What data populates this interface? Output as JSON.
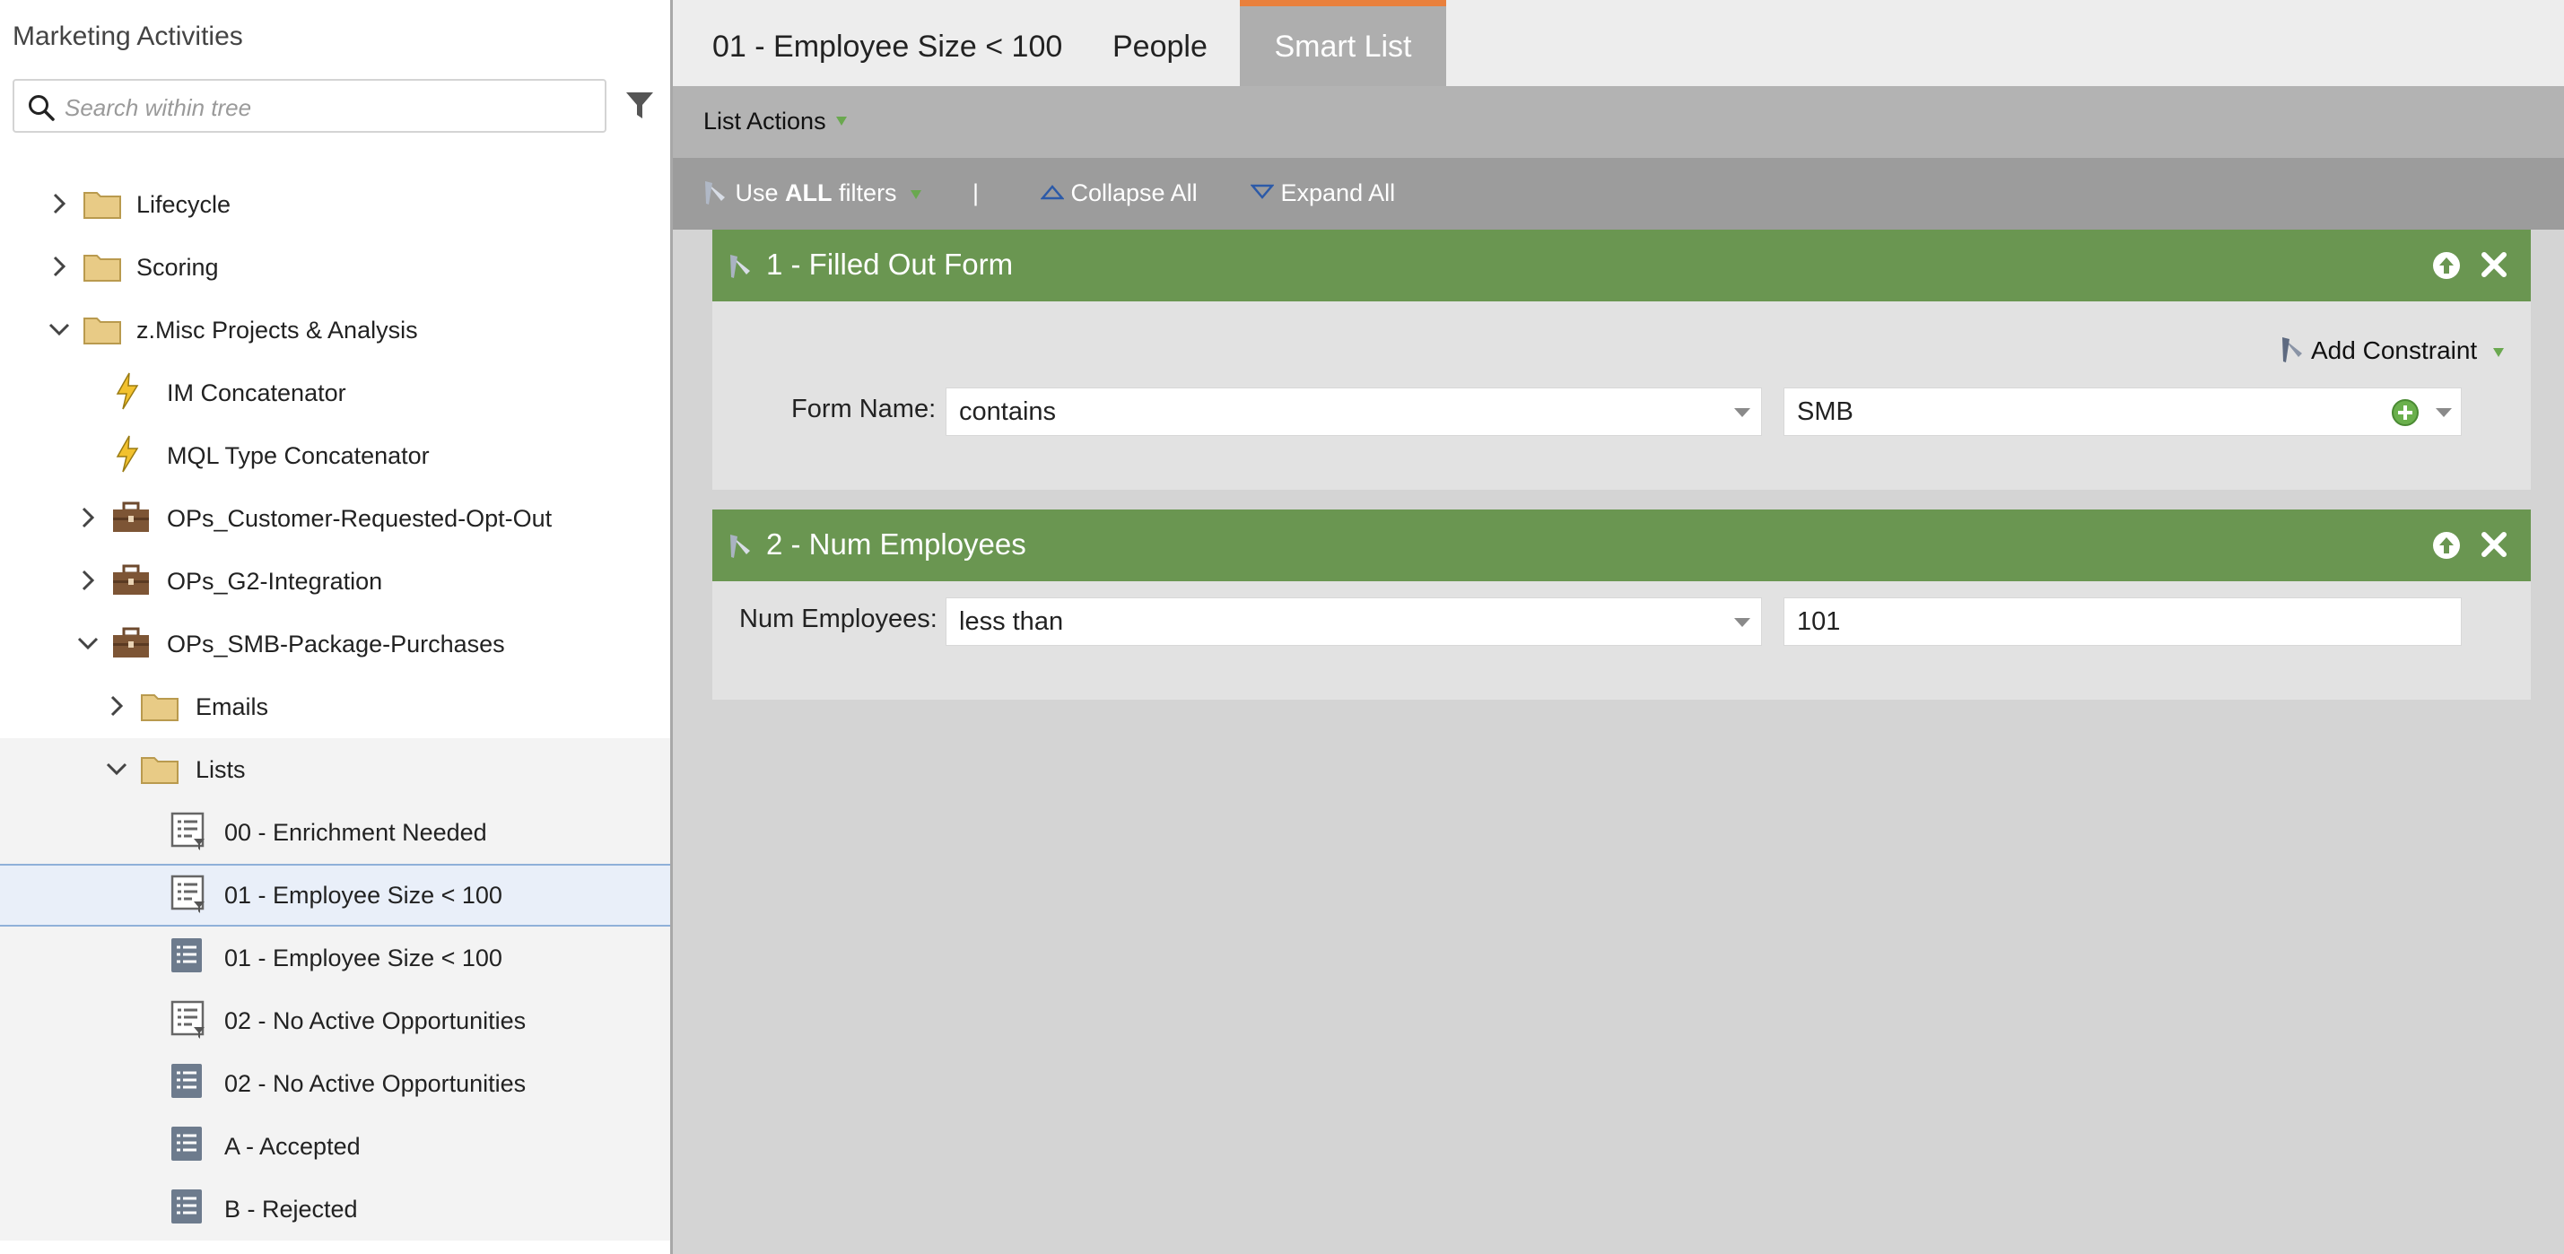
{
  "sidebar": {
    "title": "Marketing Activities",
    "search_placeholder": "Search within tree",
    "items": [
      {
        "label": "Lifecycle"
      },
      {
        "label": "Scoring"
      },
      {
        "label": "z.Misc Projects & Analysis"
      },
      {
        "label": "IM Concatenator"
      },
      {
        "label": "MQL Type Concatenator"
      },
      {
        "label": "OPs_Customer-Requested-Opt-Out"
      },
      {
        "label": "OPs_G2-Integration"
      },
      {
        "label": "OPs_SMB-Package-Purchases"
      },
      {
        "label": "Emails"
      },
      {
        "label": "Lists"
      },
      {
        "label": "00 - Enrichment Needed"
      },
      {
        "label": "01 - Employee Size < 100"
      },
      {
        "label": "01 - Employee Size < 100"
      },
      {
        "label": "02 - No Active Opportunities"
      },
      {
        "label": "02 - No Active Opportunities"
      },
      {
        "label": "A - Accepted"
      },
      {
        "label": "B - Rejected"
      }
    ]
  },
  "tabs": [
    {
      "label": "01 - Employee Size < 100"
    },
    {
      "label": "People"
    },
    {
      "label": "Smart List"
    }
  ],
  "toolbar": {
    "list_actions": "List Actions",
    "use_label": "Use",
    "all_label": "ALL",
    "filters_label": "filters",
    "separator": "|",
    "collapse_all": "Collapse All",
    "expand_all": "Expand All"
  },
  "filters": [
    {
      "title": "1 - Filled Out Form",
      "add_constraint": "Add Constraint",
      "field_label": "Form Name:",
      "operator": "contains",
      "value": "SMB"
    },
    {
      "title": "2 - Num Employees",
      "field_label": "Num Employees:",
      "operator": "less than",
      "value": "101"
    }
  ],
  "colors": {
    "filter_header": "#6a9651",
    "active_tab_accent": "#e9803c",
    "selected_row": "#e9eff9"
  }
}
